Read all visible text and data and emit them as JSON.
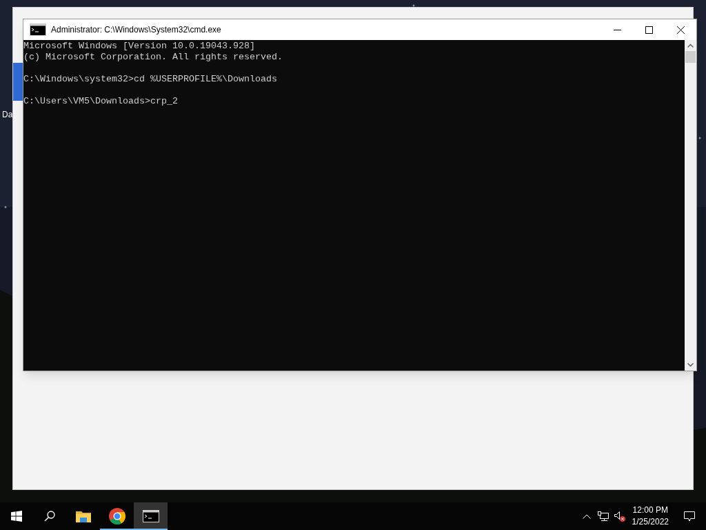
{
  "desktop": {
    "icon_label": "Da"
  },
  "window": {
    "title": "Administrator: C:\\Windows\\System32\\cmd.exe",
    "maximized": false
  },
  "console": {
    "blocks": [
      [
        "Microsoft Windows [Version 10.0.19043.928]",
        "(c) Microsoft Corporation. All rights reserved."
      ],
      [
        "C:\\Windows\\system32>cd %USERPROFILE%\\Downloads"
      ],
      [
        "C:\\Users\\VM5\\Downloads>crp_2"
      ]
    ]
  },
  "taskbar": {
    "apps": [
      {
        "kind": "explorer",
        "open": false,
        "selected": false
      },
      {
        "kind": "chrome",
        "open": true,
        "selected": false
      },
      {
        "kind": "terminal",
        "open": true,
        "selected": true
      }
    ],
    "tray": {
      "volume_muted": true
    },
    "time": "12:00 PM",
    "date": "1/25/2022"
  }
}
